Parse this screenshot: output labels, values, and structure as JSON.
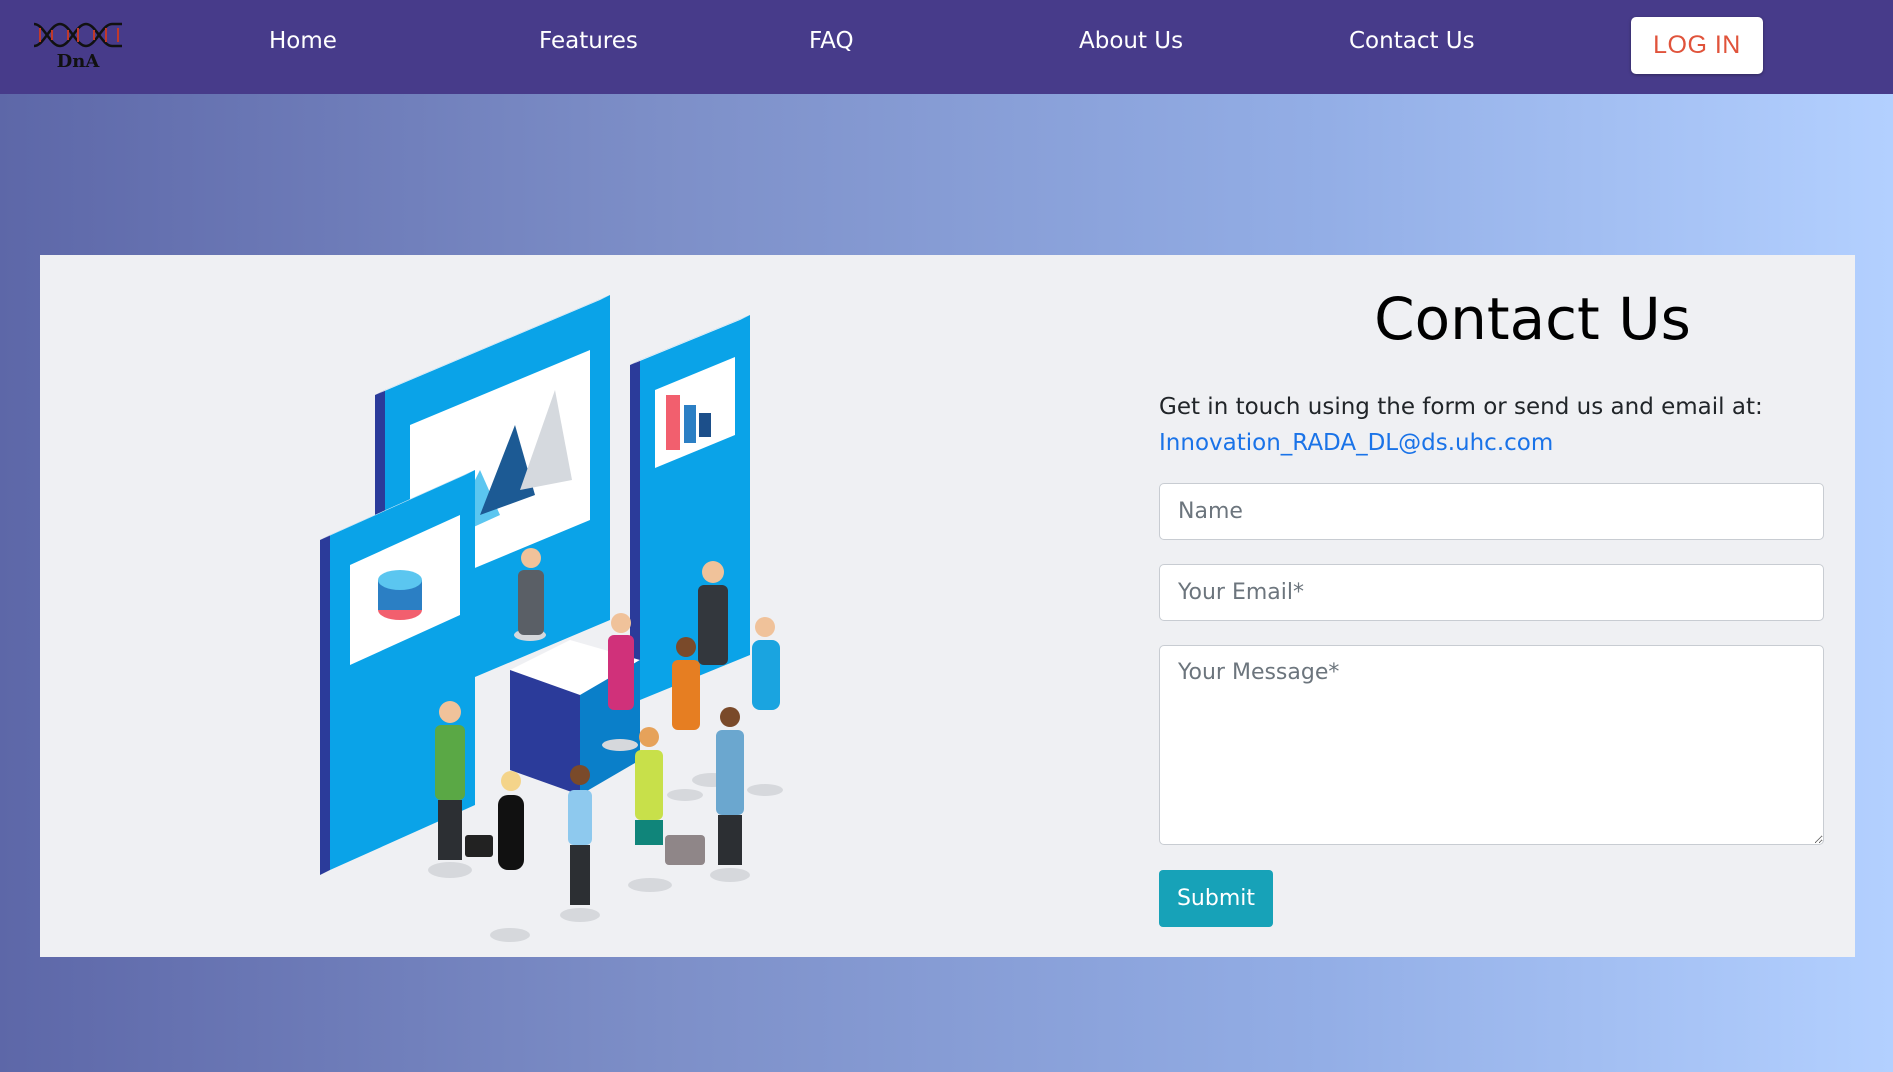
{
  "nav": {
    "logo_text": "DnA",
    "links": [
      "Home",
      "Features",
      "FAQ",
      "About Us",
      "Contact Us"
    ],
    "login_label": "LOG IN"
  },
  "contact": {
    "title": "Contact Us",
    "intro_text": "Get in touch using the form or send us and email at:",
    "email": "Innovation_RADA_DL@ds.uhc.com",
    "name_placeholder": "Name",
    "email_placeholder": "Your Email*",
    "message_placeholder": "Your Message*",
    "submit_label": "Submit"
  },
  "colors": {
    "navbar": "#473b8a",
    "login_text": "#e0533b",
    "submit": "#17a2b8",
    "link": "#1a73e8"
  },
  "icons": {
    "logo": "dna-logo-icon",
    "illustration": "exhibition-booth-illustration"
  }
}
